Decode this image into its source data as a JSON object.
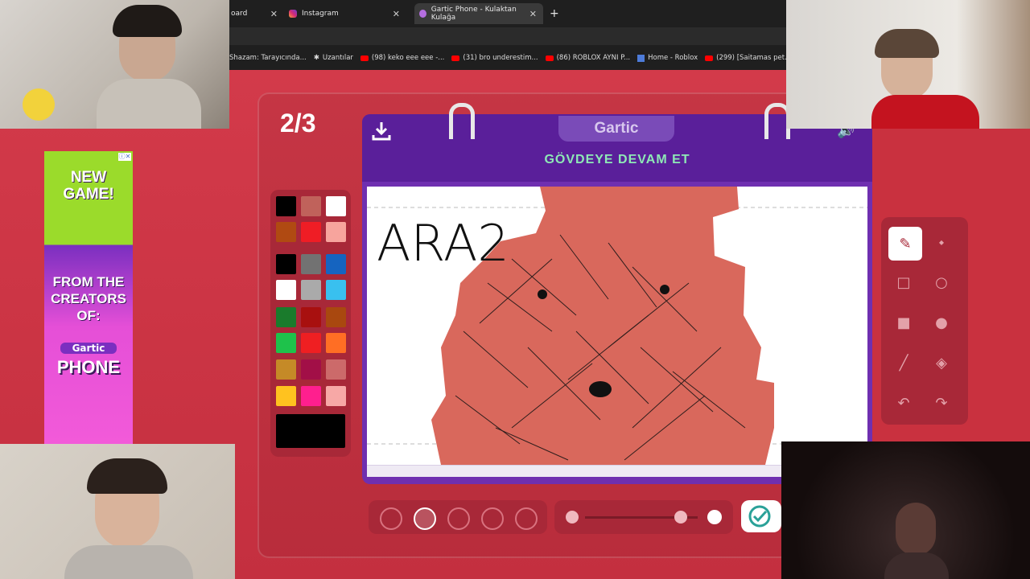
{
  "browser": {
    "tabs": [
      {
        "label": "oard",
        "icon": "tab-icon"
      },
      {
        "label": "Instagram",
        "icon": "instagram-icon"
      },
      {
        "label": "Gartic Phone - Kulaktan Kulağa",
        "icon": "gartic-icon"
      }
    ],
    "new_tab": "+",
    "bookmarks": [
      {
        "label": "Shazam: Tarayıcında...",
        "icon": "shazam-icon"
      },
      {
        "label": "Uzantılar",
        "icon": "puzzle-icon"
      },
      {
        "label": "(98) keko eee eee -...",
        "icon": "youtube-icon"
      },
      {
        "label": "(31) bro underestim...",
        "icon": "youtube-icon"
      },
      {
        "label": "(86) ROBLOX AYNI P...",
        "icon": "youtube-icon"
      },
      {
        "label": "Home - Roblox",
        "icon": "roblox-icon"
      },
      {
        "label": "(299) [Saitamas pet...",
        "icon": "youtube-icon"
      }
    ]
  },
  "game": {
    "round_counter": "2/3",
    "logo": "Gartic",
    "prompt": "GÖVDEYE DEVAM ET",
    "canvas_text": "ARA2",
    "palette_colors": [
      "#000000",
      "#c0625b",
      "#ffffff",
      "#b04a12",
      "#ef1d25",
      "#f7a49d",
      "#000000",
      "#727272",
      "#1564c0",
      "#ffffff",
      "#aaaaaa",
      "#39c0ef",
      "#1a7b2c",
      "#a8100f",
      "#a9480f",
      "#1ec24b",
      "#ef1f22",
      "#ff6e24",
      "#c58a27",
      "#a20f47",
      "#cc6a6a",
      "#ffc21f",
      "#ff1f8e",
      "#f7a8a6"
    ],
    "current_color": "#000000",
    "tools": [
      "pen-icon",
      "eraser-icon",
      "square-outline-icon",
      "circle-outline-icon",
      "square-filled-icon",
      "circle-filled-icon",
      "line-icon",
      "fill-bucket-icon",
      "undo-icon",
      "redo-icon"
    ],
    "selected_tool": "pen-icon",
    "brush_sizes": 5,
    "selected_brush_size": 2,
    "opacity_level": 0.85
  },
  "ad": {
    "headline": "NEW GAME!",
    "tagline": "FROM THE CREATORS OF:",
    "brand_top": "Gartic",
    "brand_bottom": "PHONE"
  }
}
